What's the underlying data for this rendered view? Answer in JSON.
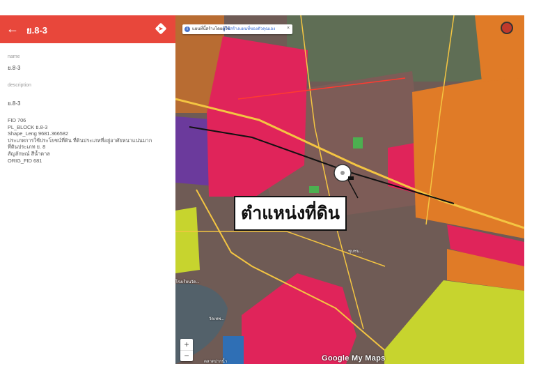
{
  "panel": {
    "title": "ย.8-3",
    "back_icon": "arrow-left-icon",
    "directions_icon": "directions-icon",
    "name_label": "name",
    "name_value": "ย.8-3",
    "description_label": "description",
    "description_value": "ย.8-3",
    "attributes": [
      "FID 706",
      "PL_BLOCK ย.8-3",
      "Shape_Leng 9681.366582",
      "ประเภทการใช้ประโยชน์ที่ดิน ที่ดินประเภทที่อยู่อาศัยหนาแน่นมาก",
      "ที่ดินประเภท ย. 8",
      "สัญลักษณ์ สีน้ำตาล",
      "ORIG_FID 681"
    ]
  },
  "map": {
    "notice_text": "แผนที่นี้สร้างโดยผู้ใช้",
    "notice_link": "ผู้ใช้สร้างแผนที่ของตัวคุณเอง",
    "notice_close": "×",
    "callout_text": "ตำแหน่งที่ดิน",
    "zoom_in": "+",
    "zoom_out": "−",
    "logo": "Google My Maps",
    "place_labels": [
      "โรงเรียนวัด...",
      "วัดเทพ...",
      "ชุมชน...",
      "ตลาดปากน้ำ"
    ],
    "colors": {
      "header": "#e8473b",
      "residential_high": "#e3245a",
      "commercial": "#e07b27",
      "agricultural": "#c8d630",
      "government": "#7b3fa3",
      "roads": "#f4c542"
    }
  }
}
